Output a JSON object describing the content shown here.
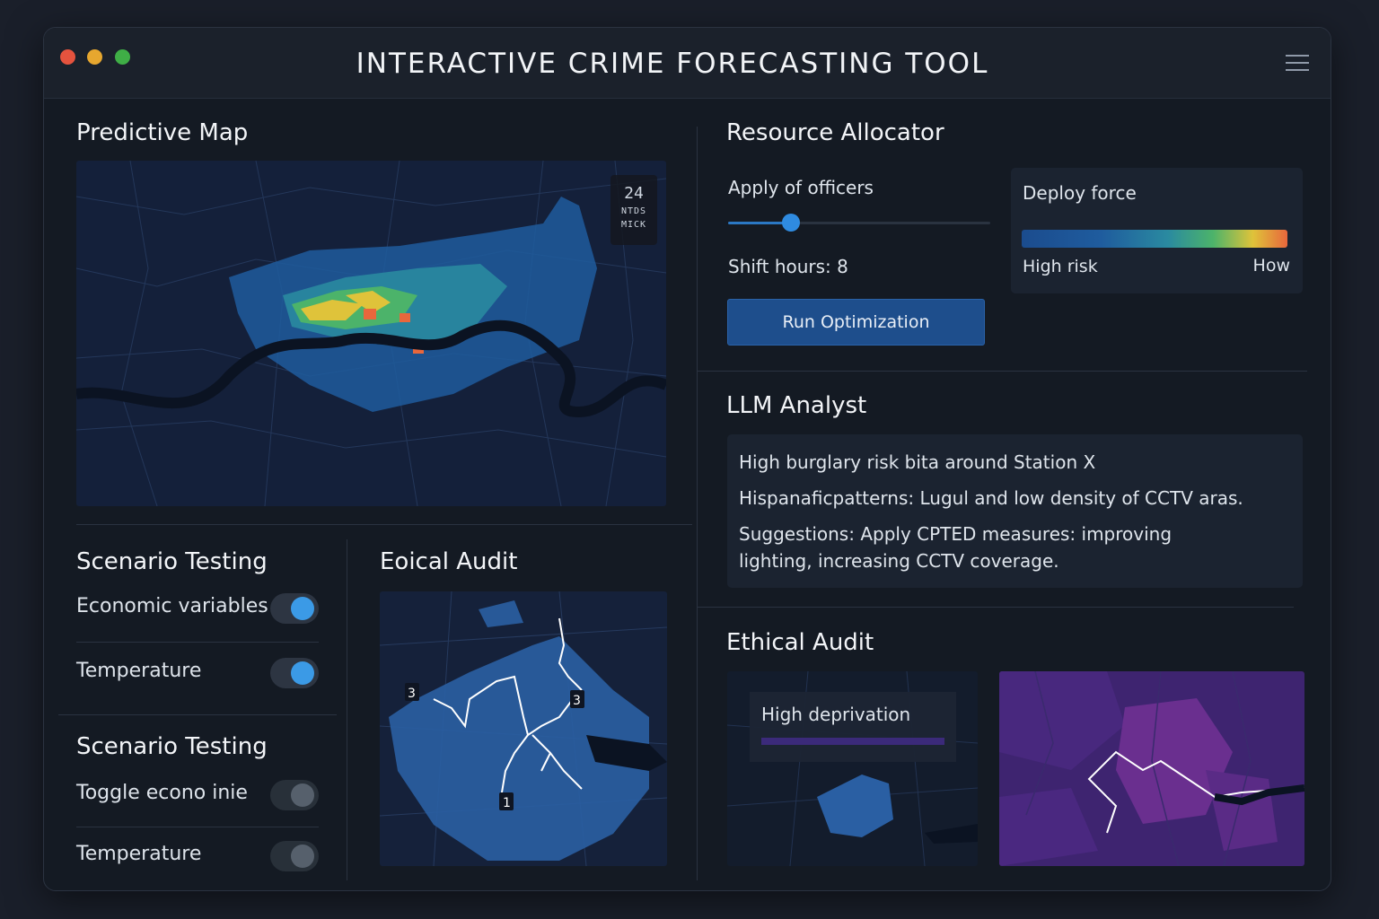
{
  "app": {
    "title": "INTERACTIVE CRIME FORECASTING TOOL"
  },
  "predictive_map": {
    "title": "Predictive Map",
    "badge_number": "24",
    "badge_line1": "NTDS",
    "badge_line2": "MICK"
  },
  "scenario_testing_1": {
    "title": "Scenario Testing",
    "toggles": [
      {
        "label": "Economic variables",
        "on": true
      },
      {
        "label": "Temperature",
        "on": true
      }
    ]
  },
  "scenario_testing_2": {
    "title": "Scenario Testing",
    "toggles": [
      {
        "label": "Toggle econo inie",
        "on": false
      },
      {
        "label": "Temperature",
        "on": false
      }
    ]
  },
  "eoical_audit": {
    "title": "Eoical Audit",
    "markers": [
      "3",
      "3",
      "1"
    ]
  },
  "resource_allocator": {
    "title": "Resource Allocator",
    "officers_label": "Apply of officers",
    "officers_slider_fraction": 0.24,
    "shift_hours_label": "Shift hours: 8",
    "run_button": "Run Optimization",
    "deploy_title": "Deploy force",
    "legend_left": "High risk",
    "legend_right": "How"
  },
  "llm_analyst": {
    "title": "LLM Analyst",
    "lines": [
      "High burglary risk bita around Station X",
      "Hispanaficpatterns: Lugul and low density of CCTV aras.",
      "Suggestions: Apply CPTED measures: improving",
      "lighting, increasing CCTV coverage."
    ]
  },
  "ethical_audit": {
    "title": "Ethical Audit",
    "deprivation_label": "High deprivation"
  },
  "colors": {
    "accent": "#2f8be0",
    "button": "#1e4e8c",
    "heat_low": "#1f5c9e",
    "heat_high": "#e8673c",
    "deprivation": "#6a2f8f"
  }
}
